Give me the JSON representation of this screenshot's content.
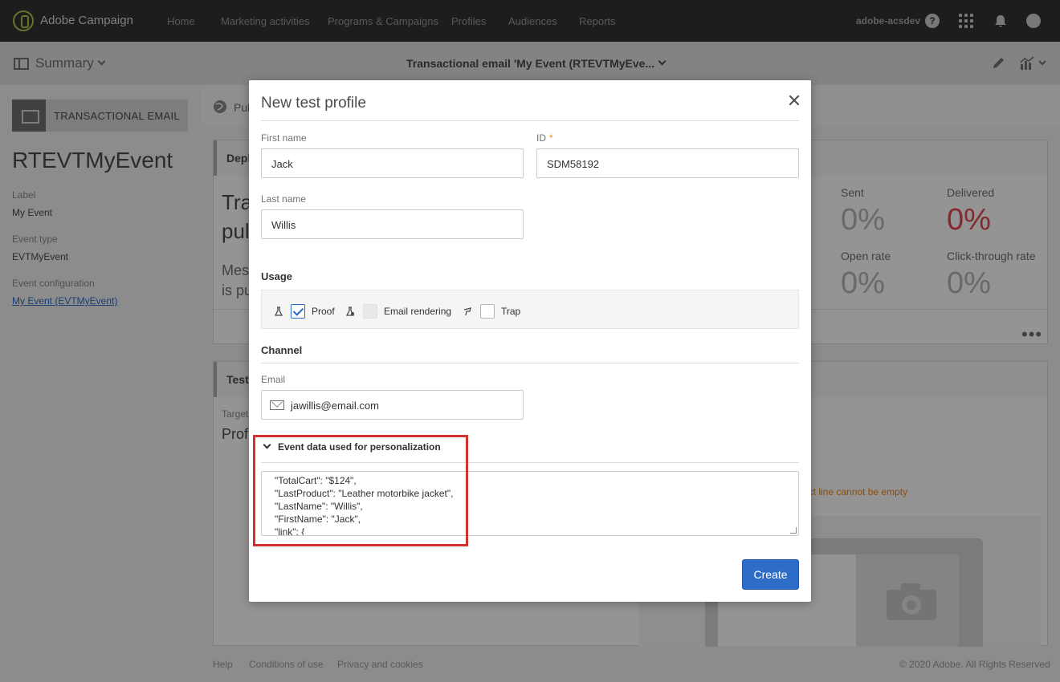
{
  "app": {
    "name": "Adobe Campaign",
    "user": "adobe-acsdev",
    "help": "?"
  },
  "nav": [
    "Home",
    "Marketing activities",
    "Programs & Campaigns",
    "Profiles",
    "Audiences",
    "Reports"
  ],
  "subbar": {
    "summary": "Summary",
    "title": "Transactional email 'My Event (RTEVTMyEve..."
  },
  "left": {
    "type": "TRANSACTIONAL EMAIL",
    "title": "RTEVTMyEvent",
    "fields": [
      {
        "label": "Label",
        "value": "My Event"
      },
      {
        "label": "Event type",
        "value": "EVTMyEvent"
      },
      {
        "label": "Event configuration",
        "value": "My Event (EVTMyEvent)"
      }
    ]
  },
  "background": {
    "tab_partial": "Pub",
    "card1_head": "Depl",
    "card1_line1": "Tra",
    "card1_line2": "pul",
    "card1_line3": "Mes",
    "card1_line4": "is pu",
    "card2_head": "Test",
    "card2_label": "Target",
    "card2_value": "Profi",
    "stats": [
      {
        "label": "Sent",
        "value": "0%"
      },
      {
        "label": "Delivered",
        "value": "0%"
      },
      {
        "label": "Open rate",
        "value": "0%"
      },
      {
        "label": "Click-through rate",
        "value": "0%"
      }
    ],
    "more": "•••",
    "warning": "ect line cannot be empty",
    "footer": [
      "Help",
      "Conditions of use",
      "Privacy and cookies"
    ],
    "copyright": "© 2020 Adobe. All Rights Reserved"
  },
  "modal": {
    "title": "New test profile",
    "first_name_label": "First name",
    "first_name": "Jack",
    "id_label": "ID",
    "id_required": "*",
    "id": "SDM58192",
    "last_name_label": "Last name",
    "last_name": "Willis",
    "usage_title": "Usage",
    "usage": [
      {
        "label": "Proof",
        "checked": true,
        "disabled": false
      },
      {
        "label": "Email rendering",
        "checked": false,
        "disabled": true
      },
      {
        "label": "Trap",
        "checked": false,
        "disabled": false
      }
    ],
    "channel_title": "Channel",
    "email_label": "Email",
    "email": "jawillis@email.com",
    "event_title": "Event data used for personalization",
    "event_json": [
      "\"TotalCart\": \"$124\",",
      "\"LastProduct\": \"Leather motorbike jacket\",",
      "\"LastName\": \"Willis\",",
      "\"FirstName\": \"Jack\",",
      "\"link\": {"
    ],
    "create": "Create"
  },
  "colors": {
    "accent": "#2d6dc7",
    "highlight": "#d1322f",
    "topbar": "#323232",
    "warning": "#e68619",
    "error": "#e34850"
  }
}
